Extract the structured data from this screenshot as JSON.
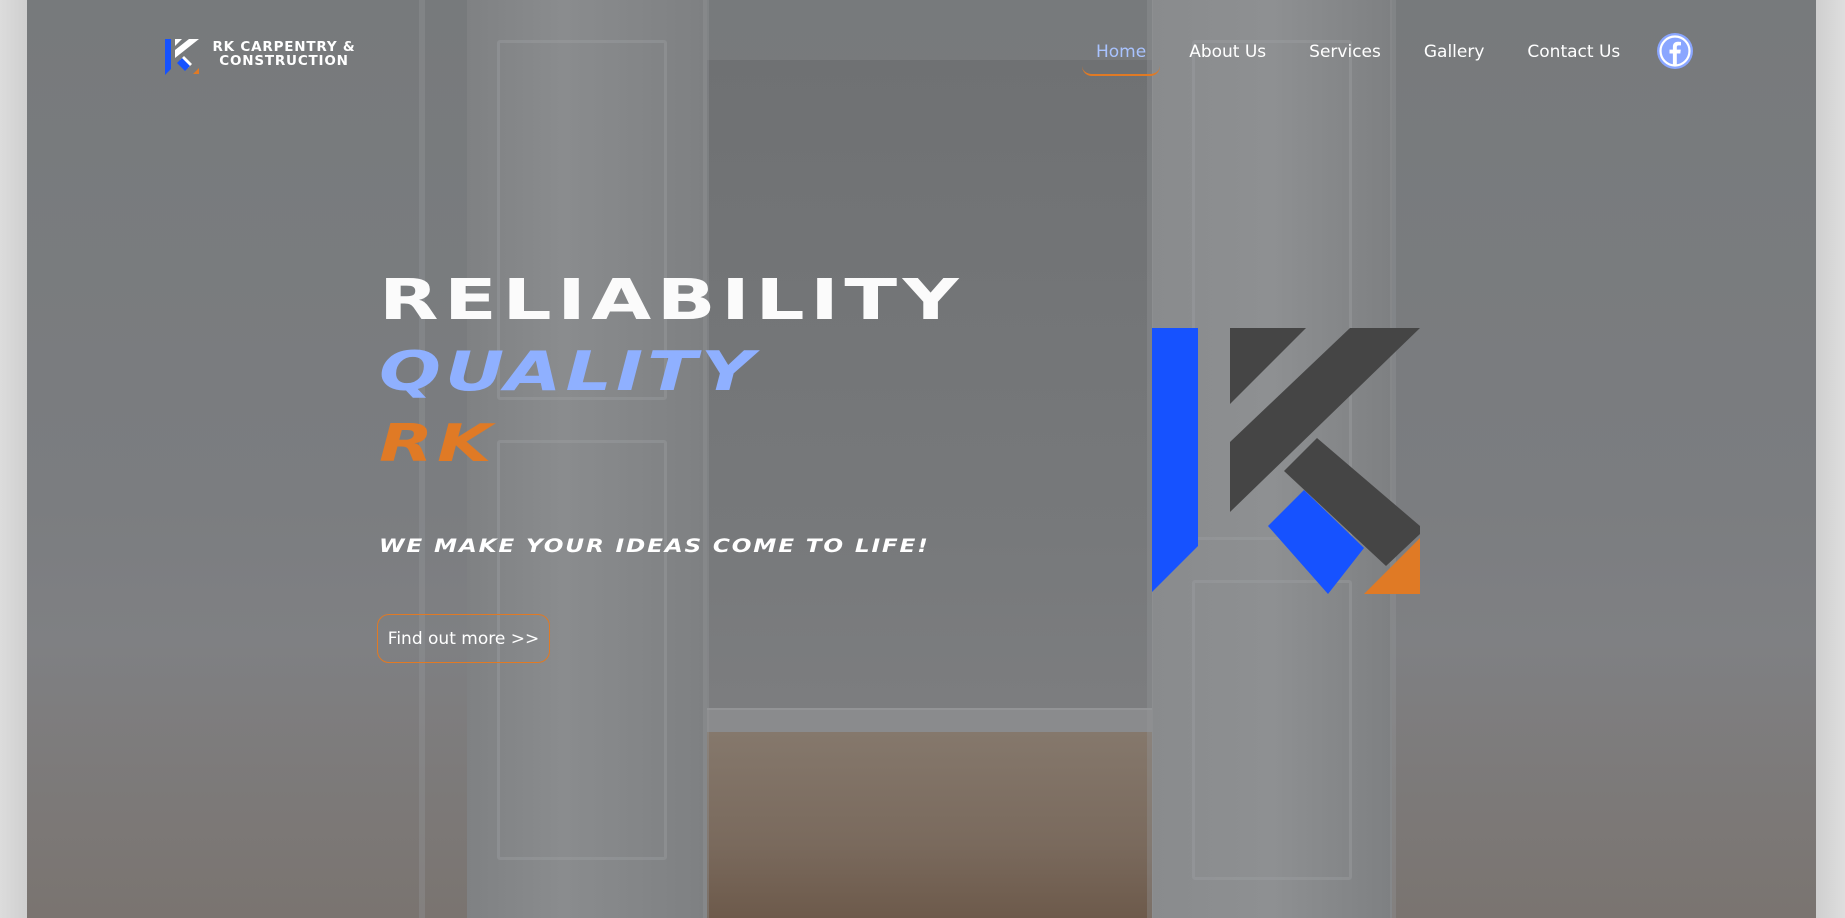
{
  "site": {
    "logo": {
      "line1": "RK CARPENTRY &",
      "line2": "CONSTRUCTION",
      "icon": "rk-logo-icon"
    }
  },
  "nav": {
    "items": [
      {
        "label": "Home",
        "active": true
      },
      {
        "label": "About Us",
        "active": false
      },
      {
        "label": "Services",
        "active": false
      },
      {
        "label": "Gallery",
        "active": false
      },
      {
        "label": "Contact Us",
        "active": false
      }
    ],
    "social_icon": "facebook-icon"
  },
  "hero": {
    "line1": "RELIABILITY",
    "line2": "QUALITY",
    "line3": "RK",
    "tagline": "WE MAKE YOUR IDEAS COME TO LIFE!",
    "cta_label": "Find out more >>",
    "graphic_icon": "rk-monogram-icon"
  },
  "colors": {
    "accent_blue": "#1652ff",
    "accent_light_blue": "#8fb0ff",
    "accent_orange": "#e07a25",
    "logo_dark": "#454545",
    "facebook_blue": "#8aa6ff"
  }
}
